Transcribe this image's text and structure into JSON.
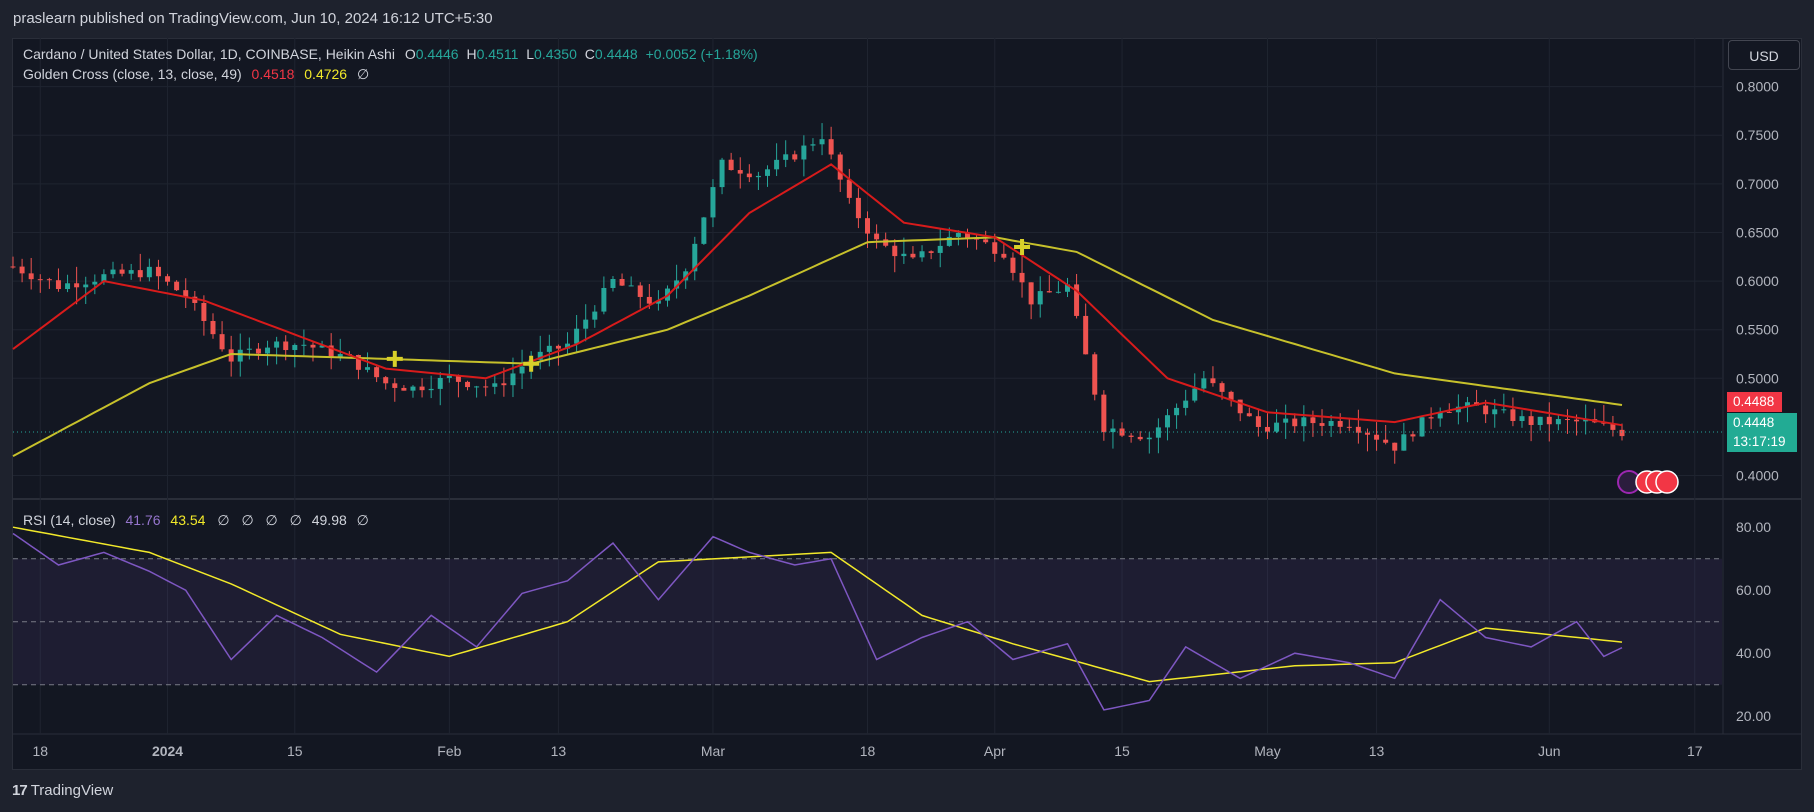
{
  "header": {
    "publisher_line": "praslearn published on TradingView.com, Jun 10, 2024 16:12 UTC+5:30"
  },
  "legend": {
    "symbol": "Cardano / United States Dollar, 1D, COINBASE, Heikin Ashi",
    "o_label": "O",
    "o_value": "0.4446",
    "h_label": "H",
    "h_value": "0.4511",
    "l_label": "L",
    "l_value": "0.4350",
    "c_label": "C",
    "c_value": "0.4448",
    "change": "+0.0052 (+1.18%)",
    "indicator_name": "Golden Cross (close, 13, close, 49)",
    "indicator_fast_value": "0.4518",
    "indicator_slow_value": "0.4726",
    "indicator_hidden_icon": "∅"
  },
  "rsi_legend": {
    "name": "RSI (14, close)",
    "rsi_value": "41.76",
    "ma_value": "43.54",
    "hidden_icons": [
      "∅",
      "∅",
      "∅",
      "∅"
    ],
    "level_value": "49.98",
    "last_icon": "∅"
  },
  "currency_button": "USD",
  "price_labels": {
    "ema_label": "0.4488",
    "last_price": "0.4448",
    "countdown": "13:17:19"
  },
  "footer": {
    "logo_glyph": "17",
    "brand": "TradingView"
  },
  "colors": {
    "background": "#131722",
    "up_candle": "#26a69a",
    "down_candle": "#ef5350",
    "fast_ma": "#d81b1b",
    "slow_ma": "#c7c12b",
    "rsi_line": "#7e57c2",
    "rsi_ma": "#f2e92a",
    "cross_marker": "#d8d02a"
  },
  "chart_data": [
    {
      "type": "candlestick",
      "title": "Cardano / United States Dollar, 1D, COINBASE, Heikin Ashi",
      "price_axis_ticks": [
        "0.8000",
        "0.7500",
        "0.7000",
        "0.6500",
        "0.6000",
        "0.5500",
        "0.5000",
        "0.4000"
      ],
      "ylim": [
        0.38,
        0.815
      ],
      "time_axis_ticks": [
        "18",
        "2024",
        "15",
        "Feb",
        "13",
        "Mar",
        "18",
        "Apr",
        "15",
        "May",
        "13",
        "Jun",
        "17"
      ],
      "xlim": [
        "2023-12-15",
        "2024-06-20"
      ],
      "grid": true,
      "ohlc_anchor_closes": [
        [
          "2023-12-15",
          0.615
        ],
        [
          "2023-12-20",
          0.595
        ],
        [
          "2023-12-25",
          0.605
        ],
        [
          "2023-12-30",
          0.61
        ],
        [
          "2024-01-03",
          0.585
        ],
        [
          "2024-01-08",
          0.52
        ],
        [
          "2024-01-12",
          0.535
        ],
        [
          "2024-01-16",
          0.535
        ],
        [
          "2024-01-21",
          0.52
        ],
        [
          "2024-01-25",
          0.495
        ],
        [
          "2024-01-28",
          0.49
        ],
        [
          "2024-02-01",
          0.5
        ],
        [
          "2024-02-06",
          0.49
        ],
        [
          "2024-02-10",
          0.52
        ],
        [
          "2024-02-14",
          0.535
        ],
        [
          "2024-02-19",
          0.6
        ],
        [
          "2024-02-24",
          0.575
        ],
        [
          "2024-02-27",
          0.615
        ],
        [
          "2024-03-02",
          0.72
        ],
        [
          "2024-03-06",
          0.71
        ],
        [
          "2024-03-10",
          0.73
        ],
        [
          "2024-03-13",
          0.75
        ],
        [
          "2024-03-16",
          0.68
        ],
        [
          "2024-03-19",
          0.64
        ],
        [
          "2024-03-23",
          0.62
        ],
        [
          "2024-03-28",
          0.65
        ],
        [
          "2024-04-02",
          0.63
        ],
        [
          "2024-04-05",
          0.58
        ],
        [
          "2024-04-09",
          0.595
        ],
        [
          "2024-04-13",
          0.45
        ],
        [
          "2024-04-18",
          0.44
        ],
        [
          "2024-04-24",
          0.5
        ],
        [
          "2024-04-30",
          0.45
        ],
        [
          "2024-05-05",
          0.455
        ],
        [
          "2024-05-10",
          0.455
        ],
        [
          "2024-05-15",
          0.43
        ],
        [
          "2024-05-20",
          0.47
        ],
        [
          "2024-05-24",
          0.47
        ],
        [
          "2024-05-30",
          0.455
        ],
        [
          "2024-06-05",
          0.455
        ],
        [
          "2024-06-09",
          0.4448
        ]
      ],
      "series": [
        {
          "name": "Golden Cross fast (13)",
          "last": 0.4518,
          "points": [
            [
              "2023-12-15",
              0.53
            ],
            [
              "2023-12-25",
              0.6
            ],
            [
              "2024-01-05",
              0.58
            ],
            [
              "2024-01-15",
              0.545
            ],
            [
              "2024-01-25",
              0.51
            ],
            [
              "2024-02-05",
              0.5
            ],
            [
              "2024-02-15",
              0.535
            ],
            [
              "2024-02-25",
              0.585
            ],
            [
              "2024-03-05",
              0.67
            ],
            [
              "2024-03-14",
              0.72
            ],
            [
              "2024-03-22",
              0.66
            ],
            [
              "2024-04-01",
              0.645
            ],
            [
              "2024-04-10",
              0.59
            ],
            [
              "2024-04-20",
              0.5
            ],
            [
              "2024-05-01",
              0.465
            ],
            [
              "2024-05-15",
              0.455
            ],
            [
              "2024-05-25",
              0.475
            ],
            [
              "2024-06-09",
              0.4518
            ]
          ]
        },
        {
          "name": "Golden Cross slow (49)",
          "last": 0.4726,
          "points": [
            [
              "2023-12-15",
              0.42
            ],
            [
              "2023-12-30",
              0.495
            ],
            [
              "2024-01-08",
              0.525
            ],
            [
              "2024-01-25",
              0.52
            ],
            [
              "2024-02-10",
              0.515
            ],
            [
              "2024-02-25",
              0.55
            ],
            [
              "2024-03-05",
              0.585
            ],
            [
              "2024-03-18",
              0.64
            ],
            [
              "2024-04-01",
              0.645
            ],
            [
              "2024-04-10",
              0.63
            ],
            [
              "2024-04-25",
              0.56
            ],
            [
              "2024-05-15",
              0.505
            ],
            [
              "2024-06-09",
              0.4726
            ]
          ]
        }
      ],
      "cross_markers": [
        [
          "2024-01-26",
          0.52
        ],
        [
          "2024-02-10",
          0.515
        ],
        [
          "2024-04-04",
          0.635
        ]
      ]
    },
    {
      "type": "line",
      "title": "RSI (14, close)",
      "ylim": [
        15,
        88
      ],
      "y_ticks": [
        "80.00",
        "60.00",
        "40.00",
        "20.00"
      ],
      "bands": {
        "upper": 70,
        "middle": 50,
        "lower": 30
      },
      "series": [
        {
          "name": "RSI",
          "last": 41.76,
          "points": [
            [
              "2023-12-15",
              78
            ],
            [
              "2023-12-20",
              68
            ],
            [
              "2023-12-25",
              72
            ],
            [
              "2023-12-30",
              66
            ],
            [
              "2024-01-03",
              60
            ],
            [
              "2024-01-08",
              38
            ],
            [
              "2024-01-13",
              52
            ],
            [
              "2024-01-18",
              45
            ],
            [
              "2024-01-24",
              34
            ],
            [
              "2024-01-30",
              52
            ],
            [
              "2024-02-04",
              42
            ],
            [
              "2024-02-09",
              59
            ],
            [
              "2024-02-14",
              63
            ],
            [
              "2024-02-19",
              75
            ],
            [
              "2024-02-24",
              57
            ],
            [
              "2024-03-01",
              77
            ],
            [
              "2024-03-05",
              72
            ],
            [
              "2024-03-10",
              68
            ],
            [
              "2024-03-14",
              70
            ],
            [
              "2024-03-19",
              38
            ],
            [
              "2024-03-24",
              45
            ],
            [
              "2024-03-29",
              50
            ],
            [
              "2024-04-03",
              38
            ],
            [
              "2024-04-09",
              43
            ],
            [
              "2024-04-13",
              22
            ],
            [
              "2024-04-18",
              25
            ],
            [
              "2024-04-22",
              42
            ],
            [
              "2024-04-28",
              32
            ],
            [
              "2024-05-04",
              40
            ],
            [
              "2024-05-10",
              37
            ],
            [
              "2024-05-15",
              32
            ],
            [
              "2024-05-20",
              57
            ],
            [
              "2024-05-25",
              45
            ],
            [
              "2024-05-30",
              42
            ],
            [
              "2024-06-04",
              50
            ],
            [
              "2024-06-07",
              39
            ],
            [
              "2024-06-09",
              41.76
            ]
          ]
        },
        {
          "name": "RSI MA",
          "last": 43.54,
          "points": [
            [
              "2023-12-15",
              80
            ],
            [
              "2023-12-30",
              72
            ],
            [
              "2024-01-08",
              62
            ],
            [
              "2024-01-20",
              46
            ],
            [
              "2024-02-01",
              39
            ],
            [
              "2024-02-14",
              50
            ],
            [
              "2024-02-24",
              69
            ],
            [
              "2024-03-14",
              72
            ],
            [
              "2024-03-24",
              52
            ],
            [
              "2024-04-03",
              43
            ],
            [
              "2024-04-18",
              31
            ],
            [
              "2024-05-04",
              36
            ],
            [
              "2024-05-15",
              37
            ],
            [
              "2024-05-25",
              48
            ],
            [
              "2024-06-09",
              43.54
            ]
          ]
        }
      ]
    }
  ]
}
